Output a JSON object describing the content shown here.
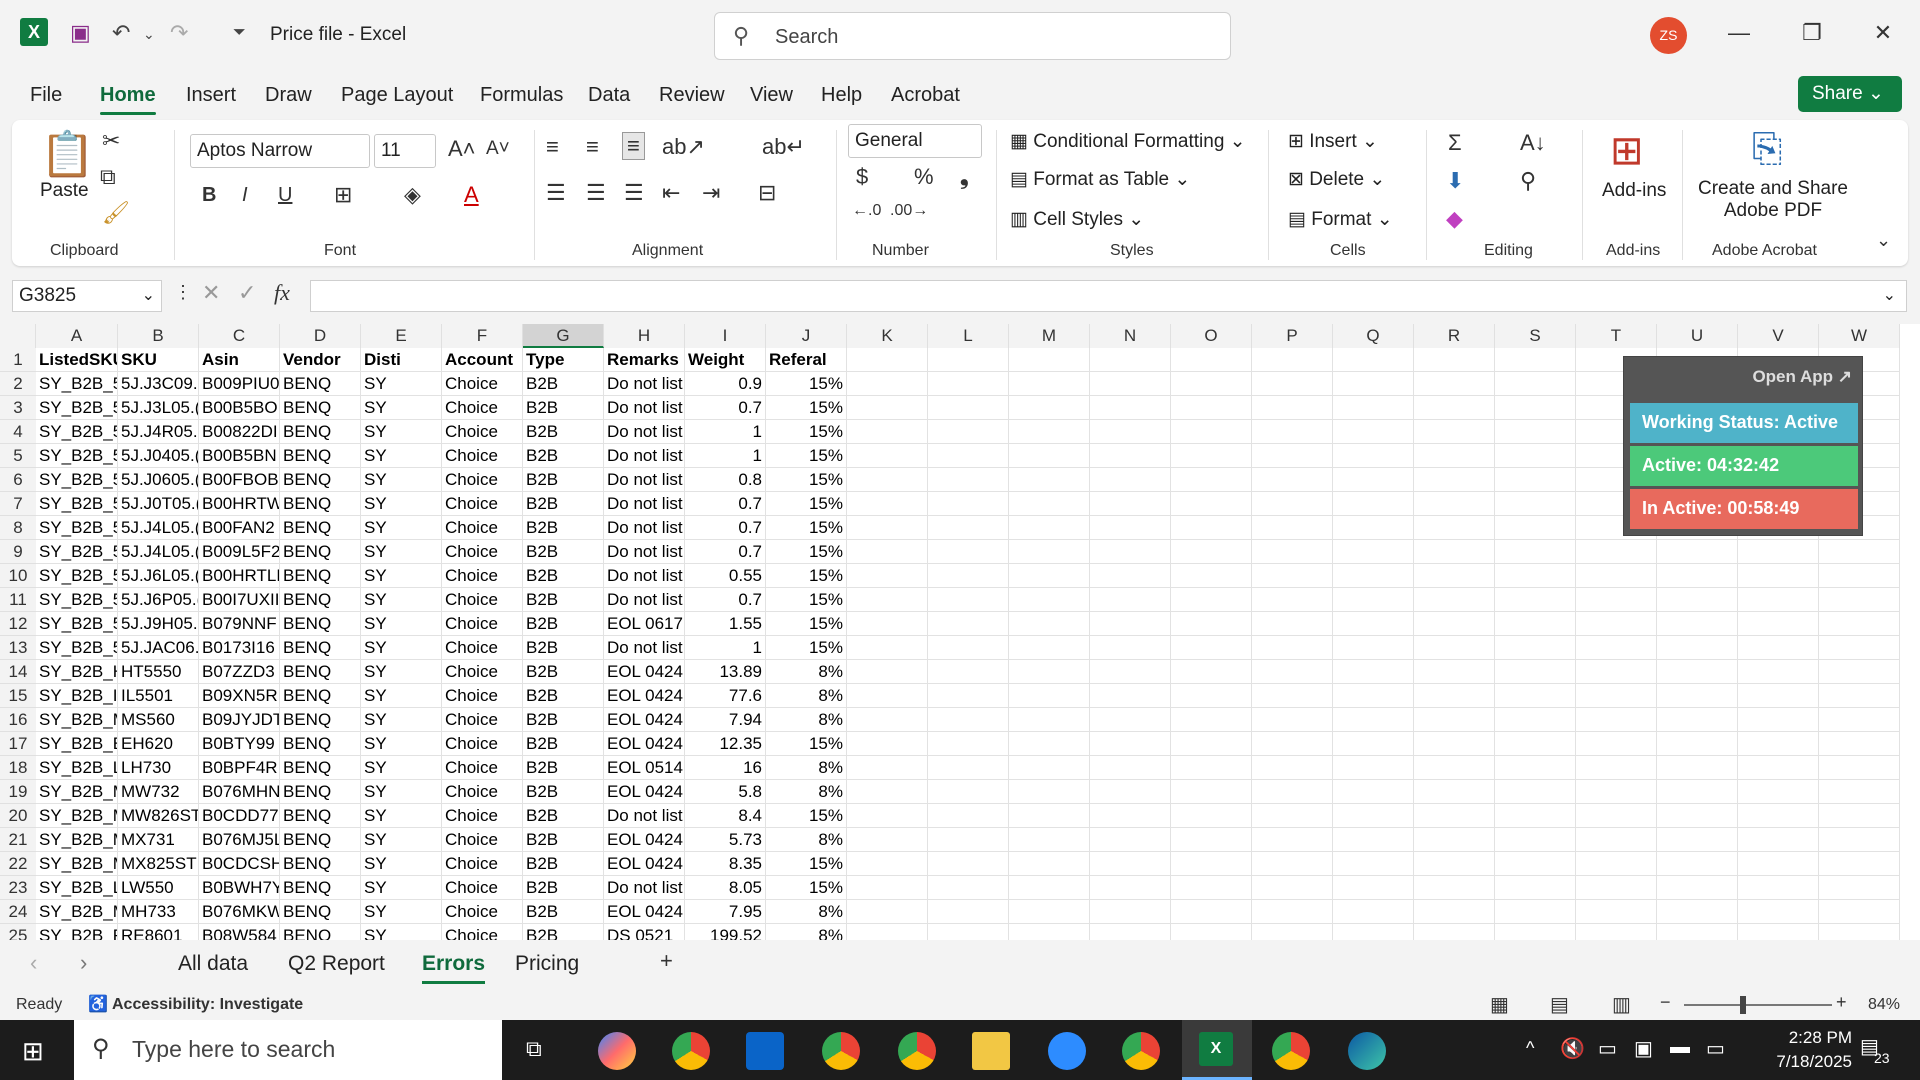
{
  "titlebar": {
    "file_title": "Price file  -  Excel",
    "search_placeholder": "Search",
    "avatar_initials": "ZS"
  },
  "ribbon_tabs": [
    "File",
    "Home",
    "Insert",
    "Draw",
    "Page Layout",
    "Formulas",
    "Data",
    "Review",
    "View",
    "Help",
    "Acrobat"
  ],
  "share_label": "Share",
  "clipboard": {
    "paste": "Paste",
    "group": "Clipboard"
  },
  "font": {
    "name": "Aptos Narrow",
    "size": "11",
    "group": "Font"
  },
  "alignment": {
    "group": "Alignment"
  },
  "number": {
    "format": "General",
    "group": "Number"
  },
  "styles": {
    "cond": "Conditional Formatting",
    "table": "Format as Table",
    "cell": "Cell Styles",
    "group": "Styles"
  },
  "cells": {
    "insert": "Insert",
    "delete": "Delete",
    "format": "Format",
    "group": "Cells"
  },
  "editing": {
    "group": "Editing"
  },
  "addins": {
    "label": "Add-ins",
    "group": "Add-ins"
  },
  "acrobat": {
    "label": "Create and Share Adobe PDF",
    "group": "Adobe Acrobat"
  },
  "namebox": "G3825",
  "columns": [
    "A",
    "B",
    "C",
    "D",
    "E",
    "F",
    "G",
    "H",
    "I",
    "J",
    "K",
    "L",
    "M",
    "N",
    "O",
    "P",
    "Q",
    "R",
    "S",
    "T",
    "U",
    "V",
    "W"
  ],
  "rows": [
    [
      "ListedSKU",
      "SKU",
      "Asin",
      "Vendor",
      "Disti",
      "Account",
      "Type",
      "Remarks",
      "Weight",
      "Referal"
    ],
    [
      "SY_B2B_5",
      "5J.J3C09.(",
      "B009PIU0",
      "BENQ",
      "SY",
      "Choice",
      "B2B",
      "Do not list",
      "0.9",
      "15%"
    ],
    [
      "SY_B2B_5",
      "5J.J3L05.(",
      "B00B5BO",
      "BENQ",
      "SY",
      "Choice",
      "B2B",
      "Do not list",
      "0.7",
      "15%"
    ],
    [
      "SY_B2B_5",
      "5J.J4R05.(",
      "B00822DI",
      "BENQ",
      "SY",
      "Choice",
      "B2B",
      "Do not list",
      "1",
      "15%"
    ],
    [
      "SY_B2B_5",
      "5J.J0405.(",
      "B00B5BN",
      "BENQ",
      "SY",
      "Choice",
      "B2B",
      "Do not list",
      "1",
      "15%"
    ],
    [
      "SY_B2B_5",
      "5J.J0605.(",
      "B00FBOB",
      "BENQ",
      "SY",
      "Choice",
      "B2B",
      "Do not list",
      "0.8",
      "15%"
    ],
    [
      "SY_B2B_5",
      "5J.J0T05.(",
      "B00HRTW",
      "BENQ",
      "SY",
      "Choice",
      "B2B",
      "Do not list",
      "0.7",
      "15%"
    ],
    [
      "SY_B2B_5",
      "5J.J4L05.(",
      "B00FAN2",
      "BENQ",
      "SY",
      "Choice",
      "B2B",
      "Do not list",
      "0.7",
      "15%"
    ],
    [
      "SY_B2B_5",
      "5J.J4L05.(",
      "B009L5F2",
      "BENQ",
      "SY",
      "Choice",
      "B2B",
      "Do not list",
      "0.7",
      "15%"
    ],
    [
      "SY_B2B_5",
      "5J.J6L05.(",
      "B00HRTLF",
      "BENQ",
      "SY",
      "Choice",
      "B2B",
      "Do not list",
      "0.55",
      "15%"
    ],
    [
      "SY_B2B_5",
      "5J.J6P05.(",
      "B00I7UXII",
      "BENQ",
      "SY",
      "Choice",
      "B2B",
      "Do not list",
      "0.7",
      "15%"
    ],
    [
      "SY_B2B_5",
      "5J.J9H05.(",
      "B079NNF",
      "BENQ",
      "SY",
      "Choice",
      "B2B",
      "EOL 0617",
      "1.55",
      "15%"
    ],
    [
      "SY_B2B_5",
      "5J.JAC06.(",
      "B0173I16",
      "BENQ",
      "SY",
      "Choice",
      "B2B",
      "Do not list",
      "1",
      "15%"
    ],
    [
      "SY_B2B_H",
      "HT5550",
      "B07ZZD3",
      "BENQ",
      "SY",
      "Choice",
      "B2B",
      "EOL 0424",
      "13.89",
      "8%"
    ],
    [
      "SY_B2B_II",
      "IL5501",
      "B09XN5R",
      "BENQ",
      "SY",
      "Choice",
      "B2B",
      "EOL 0424",
      "77.6",
      "8%"
    ],
    [
      "SY_B2B_M",
      "MS560",
      "B09JYJDT",
      "BENQ",
      "SY",
      "Choice",
      "B2B",
      "EOL 0424",
      "7.94",
      "8%"
    ],
    [
      "SY_B2B_E",
      "EH620",
      "B0BTY99",
      "BENQ",
      "SY",
      "Choice",
      "B2B",
      "EOL 0424",
      "12.35",
      "15%"
    ],
    [
      "SY_B2B_L",
      "LH730",
      "B0BPF4R",
      "BENQ",
      "SY",
      "Choice",
      "B2B",
      "EOL 0514",
      "16",
      "8%"
    ],
    [
      "SY_B2B_M",
      "MW732",
      "B076MHN",
      "BENQ",
      "SY",
      "Choice",
      "B2B",
      "EOL 0424",
      "5.8",
      "8%"
    ],
    [
      "SY_B2B_M",
      "MW826ST",
      "B0CDD77",
      "BENQ",
      "SY",
      "Choice",
      "B2B",
      "Do not list",
      "8.4",
      "15%"
    ],
    [
      "SY_B2B_M",
      "MX731",
      "B076MJ5L",
      "BENQ",
      "SY",
      "Choice",
      "B2B",
      "EOL 0424",
      "5.73",
      "8%"
    ],
    [
      "SY_B2B_M",
      "MX825STI",
      "B0CDCSH",
      "BENQ",
      "SY",
      "Choice",
      "B2B",
      "EOL 0424",
      "8.35",
      "15%"
    ],
    [
      "SY_B2B_L",
      "LW550",
      "B0BWH7Y",
      "BENQ",
      "SY",
      "Choice",
      "B2B",
      "Do not list",
      "8.05",
      "15%"
    ],
    [
      "SY_B2B_M",
      "MH733",
      "B076MKW",
      "BENQ",
      "SY",
      "Choice",
      "B2B",
      "EOL 0424",
      "7.95",
      "8%"
    ],
    [
      "SY_B2B_R",
      "RE8601",
      "B08W584",
      "BENQ",
      "SY",
      "Choice",
      "B2B",
      "DS 0521",
      "199.52",
      "8%"
    ]
  ],
  "widget": {
    "open_app": "Open App ↗",
    "working": "Working Status: Active",
    "active": "Active: 04:32:42",
    "inactive": "In Active: 00:58:49",
    "colors": {
      "working": "#4fb3c9",
      "active": "#4cc97a",
      "inactive": "#e86a5d"
    }
  },
  "sheet_tabs": [
    "All data",
    "Q2 Report",
    "Errors",
    "Pricing"
  ],
  "status": {
    "ready": "Ready",
    "accessibility": "Accessibility: Investigate",
    "zoom": "84%"
  },
  "taskbar": {
    "search_placeholder": "Type here to search",
    "time": "2:28 PM",
    "date": "7/18/2025",
    "notifications": "23"
  }
}
